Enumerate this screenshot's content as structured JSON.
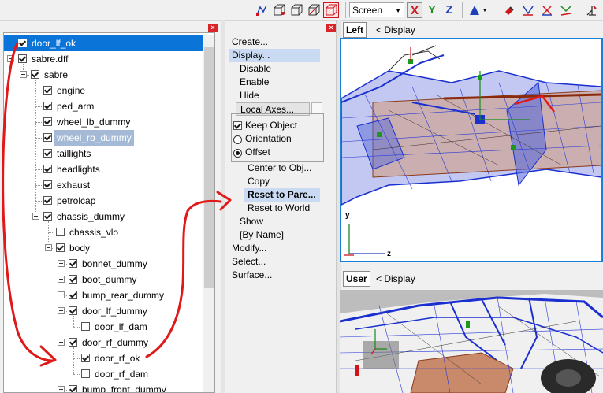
{
  "toolbar": {
    "screen_select": "Screen",
    "axis_x": "X",
    "axis_y": "Y",
    "axis_z": "Z",
    "colors": {
      "x": "#d0141a",
      "y": "#1f8a1f",
      "z": "#1d3fb8"
    }
  },
  "tree": {
    "close_symbol": "×",
    "items": [
      {
        "label": "door_lf_ok",
        "checked": true,
        "selected": true
      },
      {
        "label": "sabre.dff",
        "checked": true
      },
      {
        "label": "sabre",
        "checked": true
      },
      {
        "label": "engine",
        "checked": true
      },
      {
        "label": "ped_arm",
        "checked": true
      },
      {
        "label": "wheel_lb_dummy",
        "checked": true
      },
      {
        "label": "wheel_rb_dummy",
        "checked": true,
        "highlighted": true
      },
      {
        "label": "taillights",
        "checked": true
      },
      {
        "label": "headlights",
        "checked": true
      },
      {
        "label": "exhaust",
        "checked": true
      },
      {
        "label": "petrolcap",
        "checked": true
      },
      {
        "label": "chassis_dummy",
        "checked": true
      },
      {
        "label": "chassis_vlo",
        "checked": false
      },
      {
        "label": "body",
        "checked": true
      },
      {
        "label": "bonnet_dummy",
        "checked": true
      },
      {
        "label": "boot_dummy",
        "checked": true
      },
      {
        "label": "bump_rear_dummy",
        "checked": true
      },
      {
        "label": "door_lf_dummy",
        "checked": true
      },
      {
        "label": "door_lf_dam",
        "checked": false
      },
      {
        "label": "door_rf_dummy",
        "checked": true
      },
      {
        "label": "door_rf_ok",
        "checked": true
      },
      {
        "label": "door_rf_dam",
        "checked": false
      },
      {
        "label": "bump_front_dummy",
        "checked": true
      }
    ]
  },
  "menu": {
    "close_symbol": "×",
    "create": "Create...",
    "display": "Display...",
    "disable": "Disable",
    "enable": "Enable",
    "hide": "Hide",
    "local_axes": "Local Axes...",
    "keep_object": "Keep Object",
    "orientation": "Orientation",
    "offset": "Offset",
    "center_to_obj": "Center  to Obj...",
    "copy": "Copy",
    "reset_to_parent": "Reset to Pare...",
    "reset_to_world": "Reset to World",
    "show": "Show",
    "by_name": "[By Name]",
    "modify": "Modify...",
    "select": "Select...",
    "surface": "Surface..."
  },
  "viewports": {
    "left": {
      "tag": "Left",
      "menu": "<  Display",
      "axis_y": "y",
      "axis_z": "z"
    },
    "user": {
      "tag": "User",
      "menu": "<  Display"
    }
  }
}
